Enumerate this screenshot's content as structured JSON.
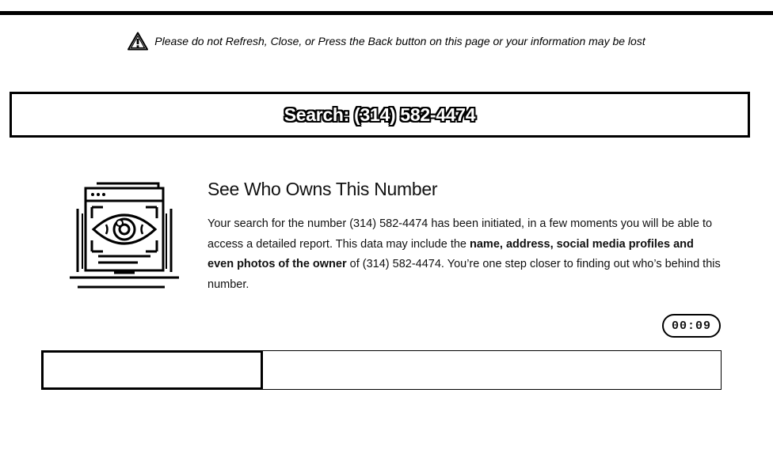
{
  "warning": {
    "text": "Please do not Refresh, Close, or Press the Back button on this page or your information may be lost",
    "icon": "warning-triangle-icon"
  },
  "search": {
    "label": "Search: (314) 582-4474"
  },
  "result": {
    "heading": "See Who Owns This Number",
    "text_1": "Your search for the number (314) 582-4474 has been initiated, in a few moments you will be able to access a detailed report. This data may include the ",
    "text_bold": "name, address, social media profiles and even photos of the owner",
    "text_2": " of (314) 582-4474. You’re one step closer to finding out who’s behind this number.",
    "illustration_icon": "laptop-eye-icon"
  },
  "timer": {
    "value": "00:09"
  },
  "progress": {
    "fraction": 0.325
  }
}
